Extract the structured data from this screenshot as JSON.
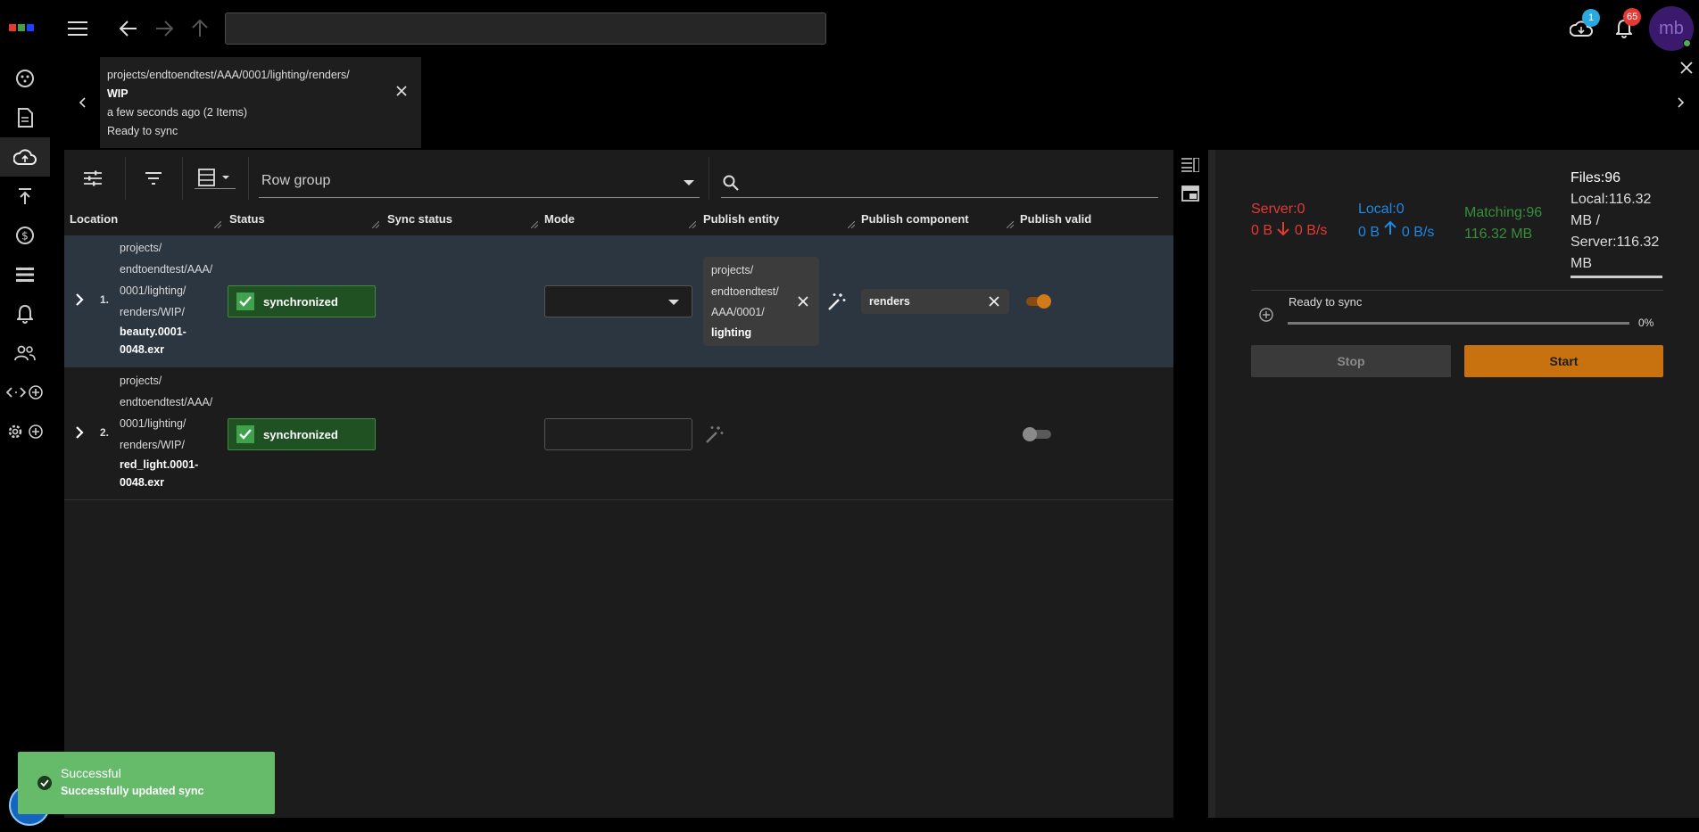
{
  "topbar": {
    "url_value": "",
    "cloud_badge": "1",
    "notification_badge": "65",
    "avatar_initials": "mb",
    "logo_colors": [
      "#e53935",
      "#43a047",
      "#1e40ff"
    ]
  },
  "rail": {
    "items": [
      "dashboard-icon",
      "document-icon",
      "cloud-sync-icon",
      "publish-icon",
      "cost-icon",
      "list-icon",
      "bell-icon",
      "users-icon",
      "code-add-icon",
      "settings-add-icon"
    ],
    "active": "cloud-sync-icon"
  },
  "breadcrumb": {
    "path": "projects/endtoendtest/AAA/0001/lighting/renders/",
    "folder": "WIP",
    "time": "a few seconds ago (2 Items)",
    "status": "Ready to sync"
  },
  "toolbar": {
    "row_group_label": "Row group",
    "search_placeholder": ""
  },
  "columns": [
    "Location",
    "Status",
    "Sync status",
    "Mode",
    "Publish entity",
    "Publish component",
    "Publish valid"
  ],
  "rows": [
    {
      "index": "1.",
      "path_lines": [
        "projects/",
        "endtoendtest/AAA/",
        "0001/lighting/",
        "renders/WIP/"
      ],
      "file_lines": [
        "beauty.0001-",
        "0048.exr"
      ],
      "status": "synchronized",
      "entity_lines": [
        "projects/",
        "endtoendtest/",
        "AAA/0001/"
      ],
      "entity_bold": "lighting",
      "component": "renders",
      "publish_valid": true
    },
    {
      "index": "2.",
      "path_lines": [
        "projects/",
        "endtoendtest/AAA/",
        "0001/lighting/",
        "renders/WIP/"
      ],
      "file_lines": [
        "red_light.0001-",
        "0048.exr"
      ],
      "status": "synchronized",
      "entity_lines": [],
      "entity_bold": "",
      "component": "",
      "publish_valid": false
    }
  ],
  "sync_panel": {
    "server_label": "Server:0",
    "server_size": "0 B",
    "server_rate": "0 B/s",
    "local_label": "Local:0",
    "local_size": "0 B",
    "local_rate": "0 B/s",
    "matching_label": "Matching:96",
    "matching_size": "116.32 MB",
    "files_label": "Files:96",
    "local_total_a": "Local:116.32",
    "local_total_b": "MB /",
    "server_total_a": "Server:116.32",
    "server_total_b": "MB",
    "status": "Ready to sync",
    "progress": "0%",
    "progress_value": 0,
    "stop_label": "Stop",
    "start_label": "Start",
    "colors": {
      "server": "#e53935",
      "local": "#1e88e5",
      "matching": "#388e3c",
      "start": "#c8720f"
    }
  },
  "toast": {
    "title": "Successful",
    "message": "Successfully updated sync"
  }
}
